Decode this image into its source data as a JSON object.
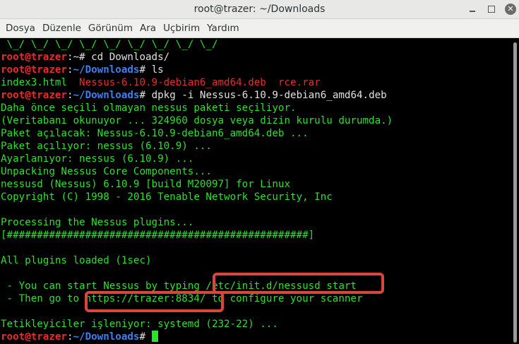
{
  "window": {
    "title": "root@trazer: ~/Downloads"
  },
  "menu": [
    "Dosya",
    "Düzenle",
    "Görünüm",
    "Ara",
    "Uçbirim",
    "Yardım"
  ],
  "prompt": {
    "user": "root@trazer",
    "cwd": "~/Downloads"
  },
  "terminal": {
    "banner": " \\_/ \\_/ \\_/ \\_/ \\_/ \\_/ \\_/ \\_/ \\_/",
    "l1_user": "root@trazer",
    "l1_rest": ":~# cd Downloads/",
    "l2_sep": ":",
    "l2_path": "~/Downloads",
    "l2_cmd": "# ls",
    "l3_file1": "index3.html  ",
    "l3_file2": "Nessus-6.10.9-debian6_amd64.deb",
    "l3_gap": "  ",
    "l3_file3": "rce.rar",
    "l4_cmd": "# dpkg -i Nessus-6.10.9-debian6_amd64.deb",
    "out": [
      "Daha önce seçili olmayan nessus paketi seçiliyor.",
      "(Veritabanı okunuyor ... 324960 dosya veya dizin kurulu durumda.)",
      "Paket açılacak: Nessus-6.10.9-debian6_amd64.deb ...",
      "Paket açılıyor: nessus (6.10.9) ...",
      "Ayarlanıyor: nessus (6.10.9) ...",
      "Unpacking Nessus Core Components...",
      "nessusd (Nessus) 6.10.9 [build M20097] for Linux",
      "Copyright (C) 1998 - 2016 Tenable Network Security, Inc",
      "",
      "Processing the Nessus plugins...",
      "[##################################################]",
      "",
      "All plugins loaded (1sec)",
      "",
      " - You can start Nessus by typing /etc/init.d/nessusd start",
      " - Then go to https://trazer:8834/ to configure your scanner",
      "",
      "Tetikleyiciler işleniyor: systemd (232-22) ..."
    ],
    "last_cmd": "# "
  },
  "highlight_color": "#d9463c",
  "text_color": "#29e229"
}
